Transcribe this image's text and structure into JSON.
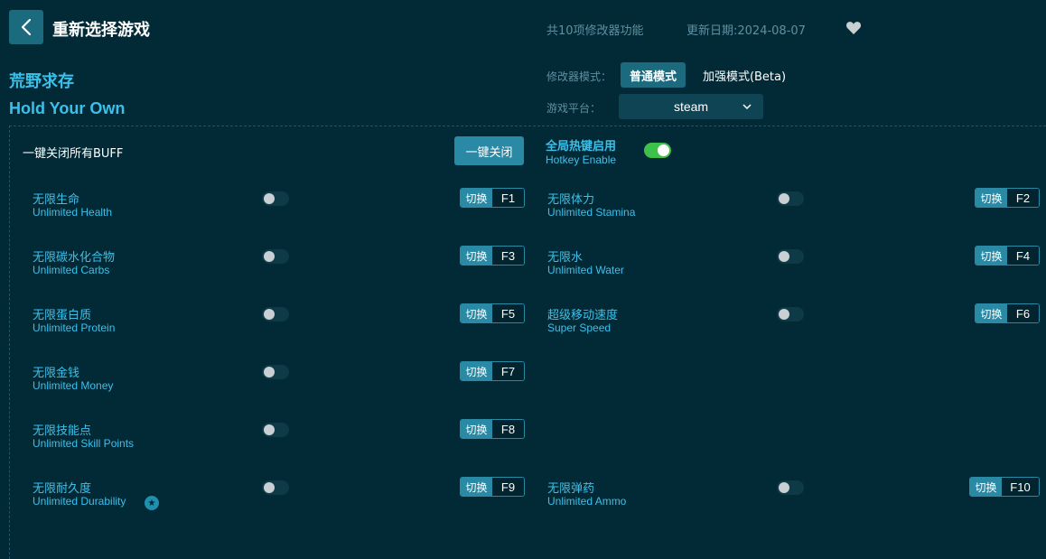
{
  "header": {
    "title": "重新选择游戏",
    "feature_count": "共10项修改器功能",
    "update_date": "更新日期:2024-08-07"
  },
  "game": {
    "name_cn": "荒野求存",
    "name_en": "Hold Your Own"
  },
  "mode": {
    "label": "修改器模式：",
    "normal": "普通模式",
    "beta": "加强模式(Beta)",
    "selected": "普通模式"
  },
  "platform": {
    "label": "游戏平台：",
    "value": "steam"
  },
  "buff": {
    "label": "一键关闭所有BUFF",
    "button": "一键关闭"
  },
  "hotkey": {
    "label_cn": "全局热键启用",
    "label_en": "Hotkey Enable",
    "enabled": true
  },
  "switch_label": "切换",
  "cheats_left": [
    {
      "cn": "无限生命",
      "en": "Unlimited Health",
      "key": "F1",
      "on": false
    },
    {
      "cn": "无限碳水化合物",
      "en": "Unlimited Carbs",
      "key": "F3",
      "on": false
    },
    {
      "cn": "无限蛋白质",
      "en": "Unlimited Protein",
      "key": "F5",
      "on": false
    },
    {
      "cn": "无限金钱",
      "en": "Unlimited Money",
      "key": "F7",
      "on": false
    },
    {
      "cn": "无限技能点",
      "en": "Unlimited Skill Points",
      "key": "F8",
      "on": false
    },
    {
      "cn": "无限耐久度",
      "en": "Unlimited Durability",
      "key": "F9",
      "on": false,
      "starred": true
    }
  ],
  "cheats_right": [
    {
      "cn": "无限体力",
      "en": "Unlimited Stamina",
      "key": "F2",
      "on": false
    },
    {
      "cn": "无限水",
      "en": "Unlimited Water",
      "key": "F4",
      "on": false
    },
    {
      "cn": "超级移动速度",
      "en": "Super Speed",
      "key": "F6",
      "on": false
    },
    {
      "cn": "无限弹药",
      "en": "Unlimited Ammo",
      "key": "F10",
      "on": false
    }
  ],
  "colors": {
    "background": "#022a36",
    "accent": "#3cc0ea",
    "button": "#2a8aa6",
    "toggle_on": "#3ec14a"
  }
}
